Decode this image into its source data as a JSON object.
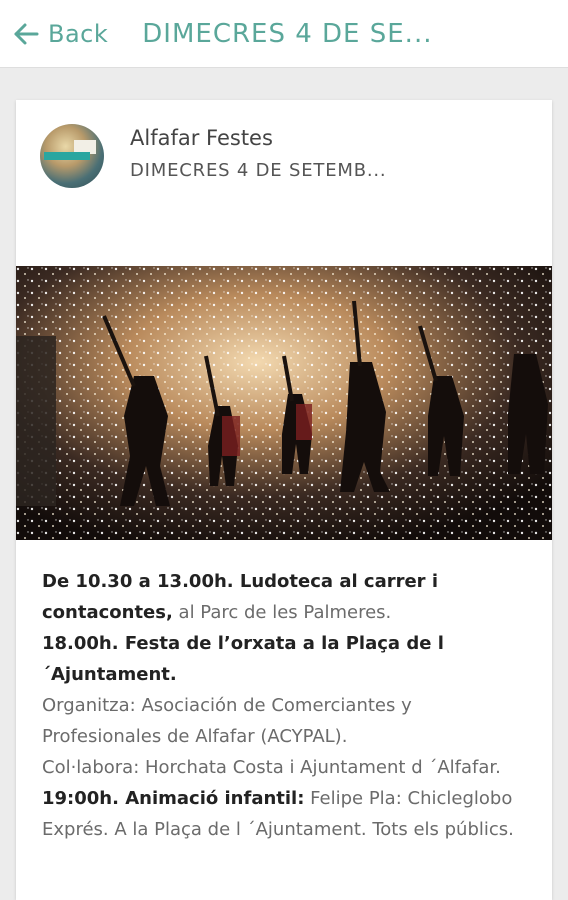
{
  "topbar": {
    "back_label": "Back",
    "title": "DIMECRES 4 DE SE..."
  },
  "post": {
    "author": "Alfafar Festes",
    "subtitle": "DIMECRES 4 DE SETEMB...",
    "image_alt": "correfoc"
  },
  "content": {
    "p1_bold": "De 10.30 a 13.00h. Ludoteca al carrer i contacontes,",
    "p1_text": " al Parc de les Palmeres.",
    "p2_bold": "18.00h. Festa de l’orxata a la Plaça de l ´Ajuntament.",
    "p3": "Organitza: Asociación de Comerciantes y Profesionales de Alfafar (ACYPAL).",
    "p4": "Col·labora: Horchata Costa i Ajuntament d ´Alfafar.",
    "p5_bold": "19:00h. Animació infantil:",
    "p5_text": " Felipe Pla: Chicleglobo Exprés. A la Plaça de l ´Ajuntament. Tots els públics."
  },
  "colors": {
    "accent": "#5aa79a"
  }
}
